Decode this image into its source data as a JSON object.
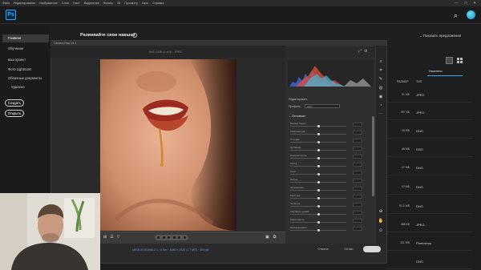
{
  "menubar": {
    "items": [
      "Файл",
      "Редактирование",
      "Изображение",
      "Слои",
      "Текст",
      "Выделение",
      "Фильтр",
      "3D",
      "Просмотр",
      "Окно",
      "Справка"
    ],
    "minimize": "—",
    "maximize": "□",
    "close": "✕"
  },
  "header": {
    "logo": "Ps"
  },
  "sidebar": {
    "items": [
      "Главная",
      "Обучение",
      "ваш проект",
      "Фото Lightroom",
      "Облачные документы",
      "Удалено"
    ],
    "create_label": "Создать",
    "open_label": "Открыть"
  },
  "main": {
    "title": "Развивайте свои навыки",
    "info": "i",
    "hide_suggestions": "Показать предложения",
    "columns": {
      "modified": "Изменено",
      "size": "РАЗМЕР",
      "type": "ТИП"
    },
    "rows": [
      {
        "size": "91 МБ",
        "type": "JPEG"
      },
      {
        "size": "397 КБ",
        "type": "JPEG"
      },
      {
        "size": "16 МБ",
        "type": "DNG"
      },
      {
        "size": "45 МБ",
        "type": "DNG"
      },
      {
        "size": "27 МБ",
        "type": "DNG"
      },
      {
        "size": "12 МБ",
        "type": "DNG"
      },
      {
        "size": "51,1 МБ",
        "type": "DNG"
      },
      {
        "size": "488 КБ",
        "type": "JPEG"
      },
      {
        "size": "311 МБ",
        "type": "Photoshop"
      },
      {
        "size": "",
        "type": "DNG"
      }
    ]
  },
  "dialog": {
    "title": "Camera Raw 14.3",
    "filename": "IMG_0126 (1 of 6)  ·  JPEG",
    "panel": {
      "edit_label": "Редактировать",
      "profile_label": "Профиль",
      "profile_value": "Цвет",
      "basic_header": "Основные",
      "sliders": [
        {
          "label": "Баланс белых",
          "pos": 0.5
        },
        {
          "label": "Температура",
          "pos": 0.5
        },
        {
          "label": "Оттенок",
          "pos": 0.5
        },
        {
          "label": "Экспонир.",
          "pos": 0.5
        },
        {
          "label": "Контрастность",
          "pos": 0.5
        },
        {
          "label": "Света",
          "pos": 0.5
        },
        {
          "label": "Тени",
          "pos": 0.5
        },
        {
          "label": "Белые",
          "pos": 0.5
        },
        {
          "label": "Затемнение",
          "pos": 0.5
        },
        {
          "label": "Текстура",
          "pos": 0.5
        },
        {
          "label": "Четкость",
          "pos": 0.5
        },
        {
          "label": "Удаление дымки",
          "pos": 0.5
        },
        {
          "label": "Красочность",
          "pos": 0.5
        },
        {
          "label": "Насыщенность",
          "pos": 0.5
        }
      ]
    },
    "status": "sRGB IEC61966-2.1 · 8 бит · 1080 × 1620 (1,7 МП) · 300 ppi",
    "cancel_label": "Отмена",
    "done_label": "Готово",
    "open_label": ""
  },
  "colors": {
    "accent": "#31a8ff",
    "dialog_bg": "#2a2a2a",
    "app_bg": "#1e1e1e"
  },
  "icons": [
    "search-icon",
    "avatar",
    "info-icon",
    "list-view-icon",
    "grid-view-icon",
    "zoom-icon",
    "hand-icon",
    "filter-icon",
    "settings-icon",
    "fullscreen-icon",
    "edit-tool-icon",
    "crop-icon",
    "heal-icon",
    "mask-icon",
    "redeye-icon",
    "presets-icon",
    "more-icon"
  ]
}
